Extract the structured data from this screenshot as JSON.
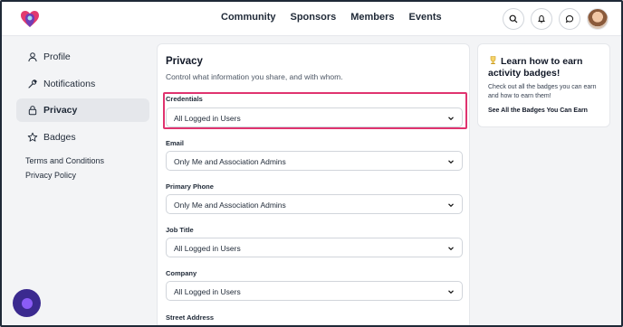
{
  "nav": [
    "Community",
    "Sponsors",
    "Members",
    "Events"
  ],
  "header": {
    "icons": [
      "search-icon",
      "bell-icon",
      "chat-icon"
    ]
  },
  "sidebar": {
    "items": [
      {
        "label": "Profile",
        "icon": "person-icon"
      },
      {
        "label": "Notifications",
        "icon": "wrench-icon"
      },
      {
        "label": "Privacy",
        "icon": "lock-icon",
        "active": true
      },
      {
        "label": "Badges",
        "icon": "star-icon"
      }
    ],
    "links": [
      "Terms and Conditions",
      "Privacy Policy"
    ]
  },
  "privacy": {
    "title": "Privacy",
    "subtitle": "Control what information you share, and with whom.",
    "fields": [
      {
        "label": "Credentials",
        "value": "All Logged in Users"
      },
      {
        "label": "Email",
        "value": "Only Me and Association Admins"
      },
      {
        "label": "Primary Phone",
        "value": "Only Me and Association Admins"
      },
      {
        "label": "Job Title",
        "value": "All Logged in Users"
      },
      {
        "label": "Company",
        "value": "All Logged in Users"
      },
      {
        "label": "Street Address",
        "value": ""
      }
    ]
  },
  "badges": {
    "title": "Learn how to earn activity badges!",
    "text": "Check out all the badges you can earn and how to earn them!",
    "link": "See All the Badges You Can Earn"
  },
  "colors": {
    "highlight": "#e0336f",
    "fab": "#3b2a8f"
  }
}
